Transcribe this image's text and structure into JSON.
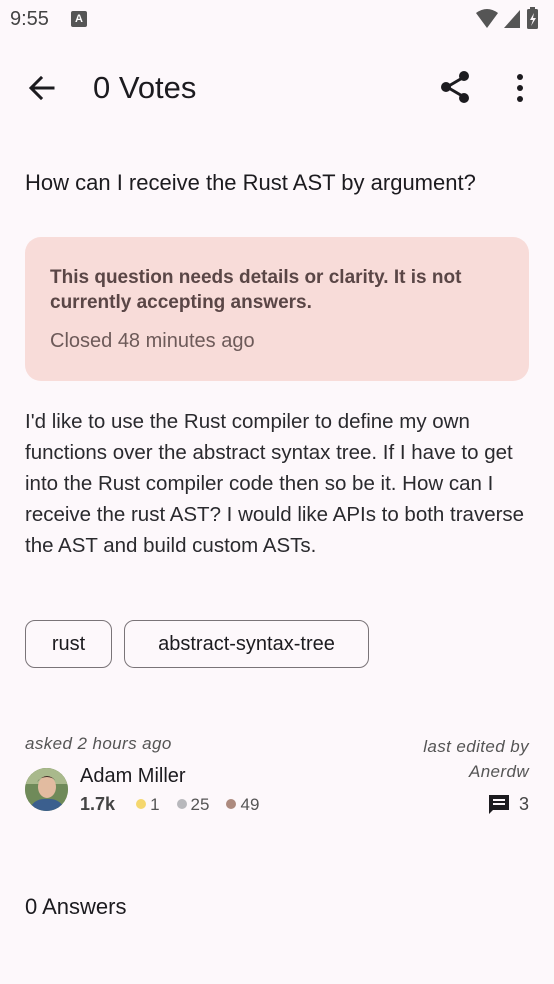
{
  "status_bar": {
    "time": "9:55",
    "notification_glyph": "A"
  },
  "app_bar": {
    "title": "0 Votes"
  },
  "question": {
    "title": "How can I receive the Rust AST by argument?",
    "closed_reason": "This question needs details or clarity. It is not currently accepting answers.",
    "closed_time": "Closed 48 minutes ago",
    "body": "I'd like to use the Rust compiler to define my own functions over the abstract syntax tree. If I have to get into the Rust compiler code then so be it. How can I receive the rust AST? I would like APIs to both traverse the AST and build custom ASTs.",
    "tags": [
      "rust",
      "abstract-syntax-tree"
    ],
    "asked": "asked 2 hours ago",
    "author": {
      "name": "Adam Miller",
      "reputation": "1.7k",
      "gold": "1",
      "silver": "25",
      "bronze": "49"
    },
    "edited_label": "last edited by",
    "edited_by": "Anerdw",
    "comment_count": "3"
  },
  "answers_heading": "0 Answers",
  "colors": {
    "background": "#fdf8fb",
    "closed_card": "#f8dcd9",
    "gold": "#f5d76e",
    "silver": "#b8b8bc",
    "bronze": "#ad8a7e"
  }
}
